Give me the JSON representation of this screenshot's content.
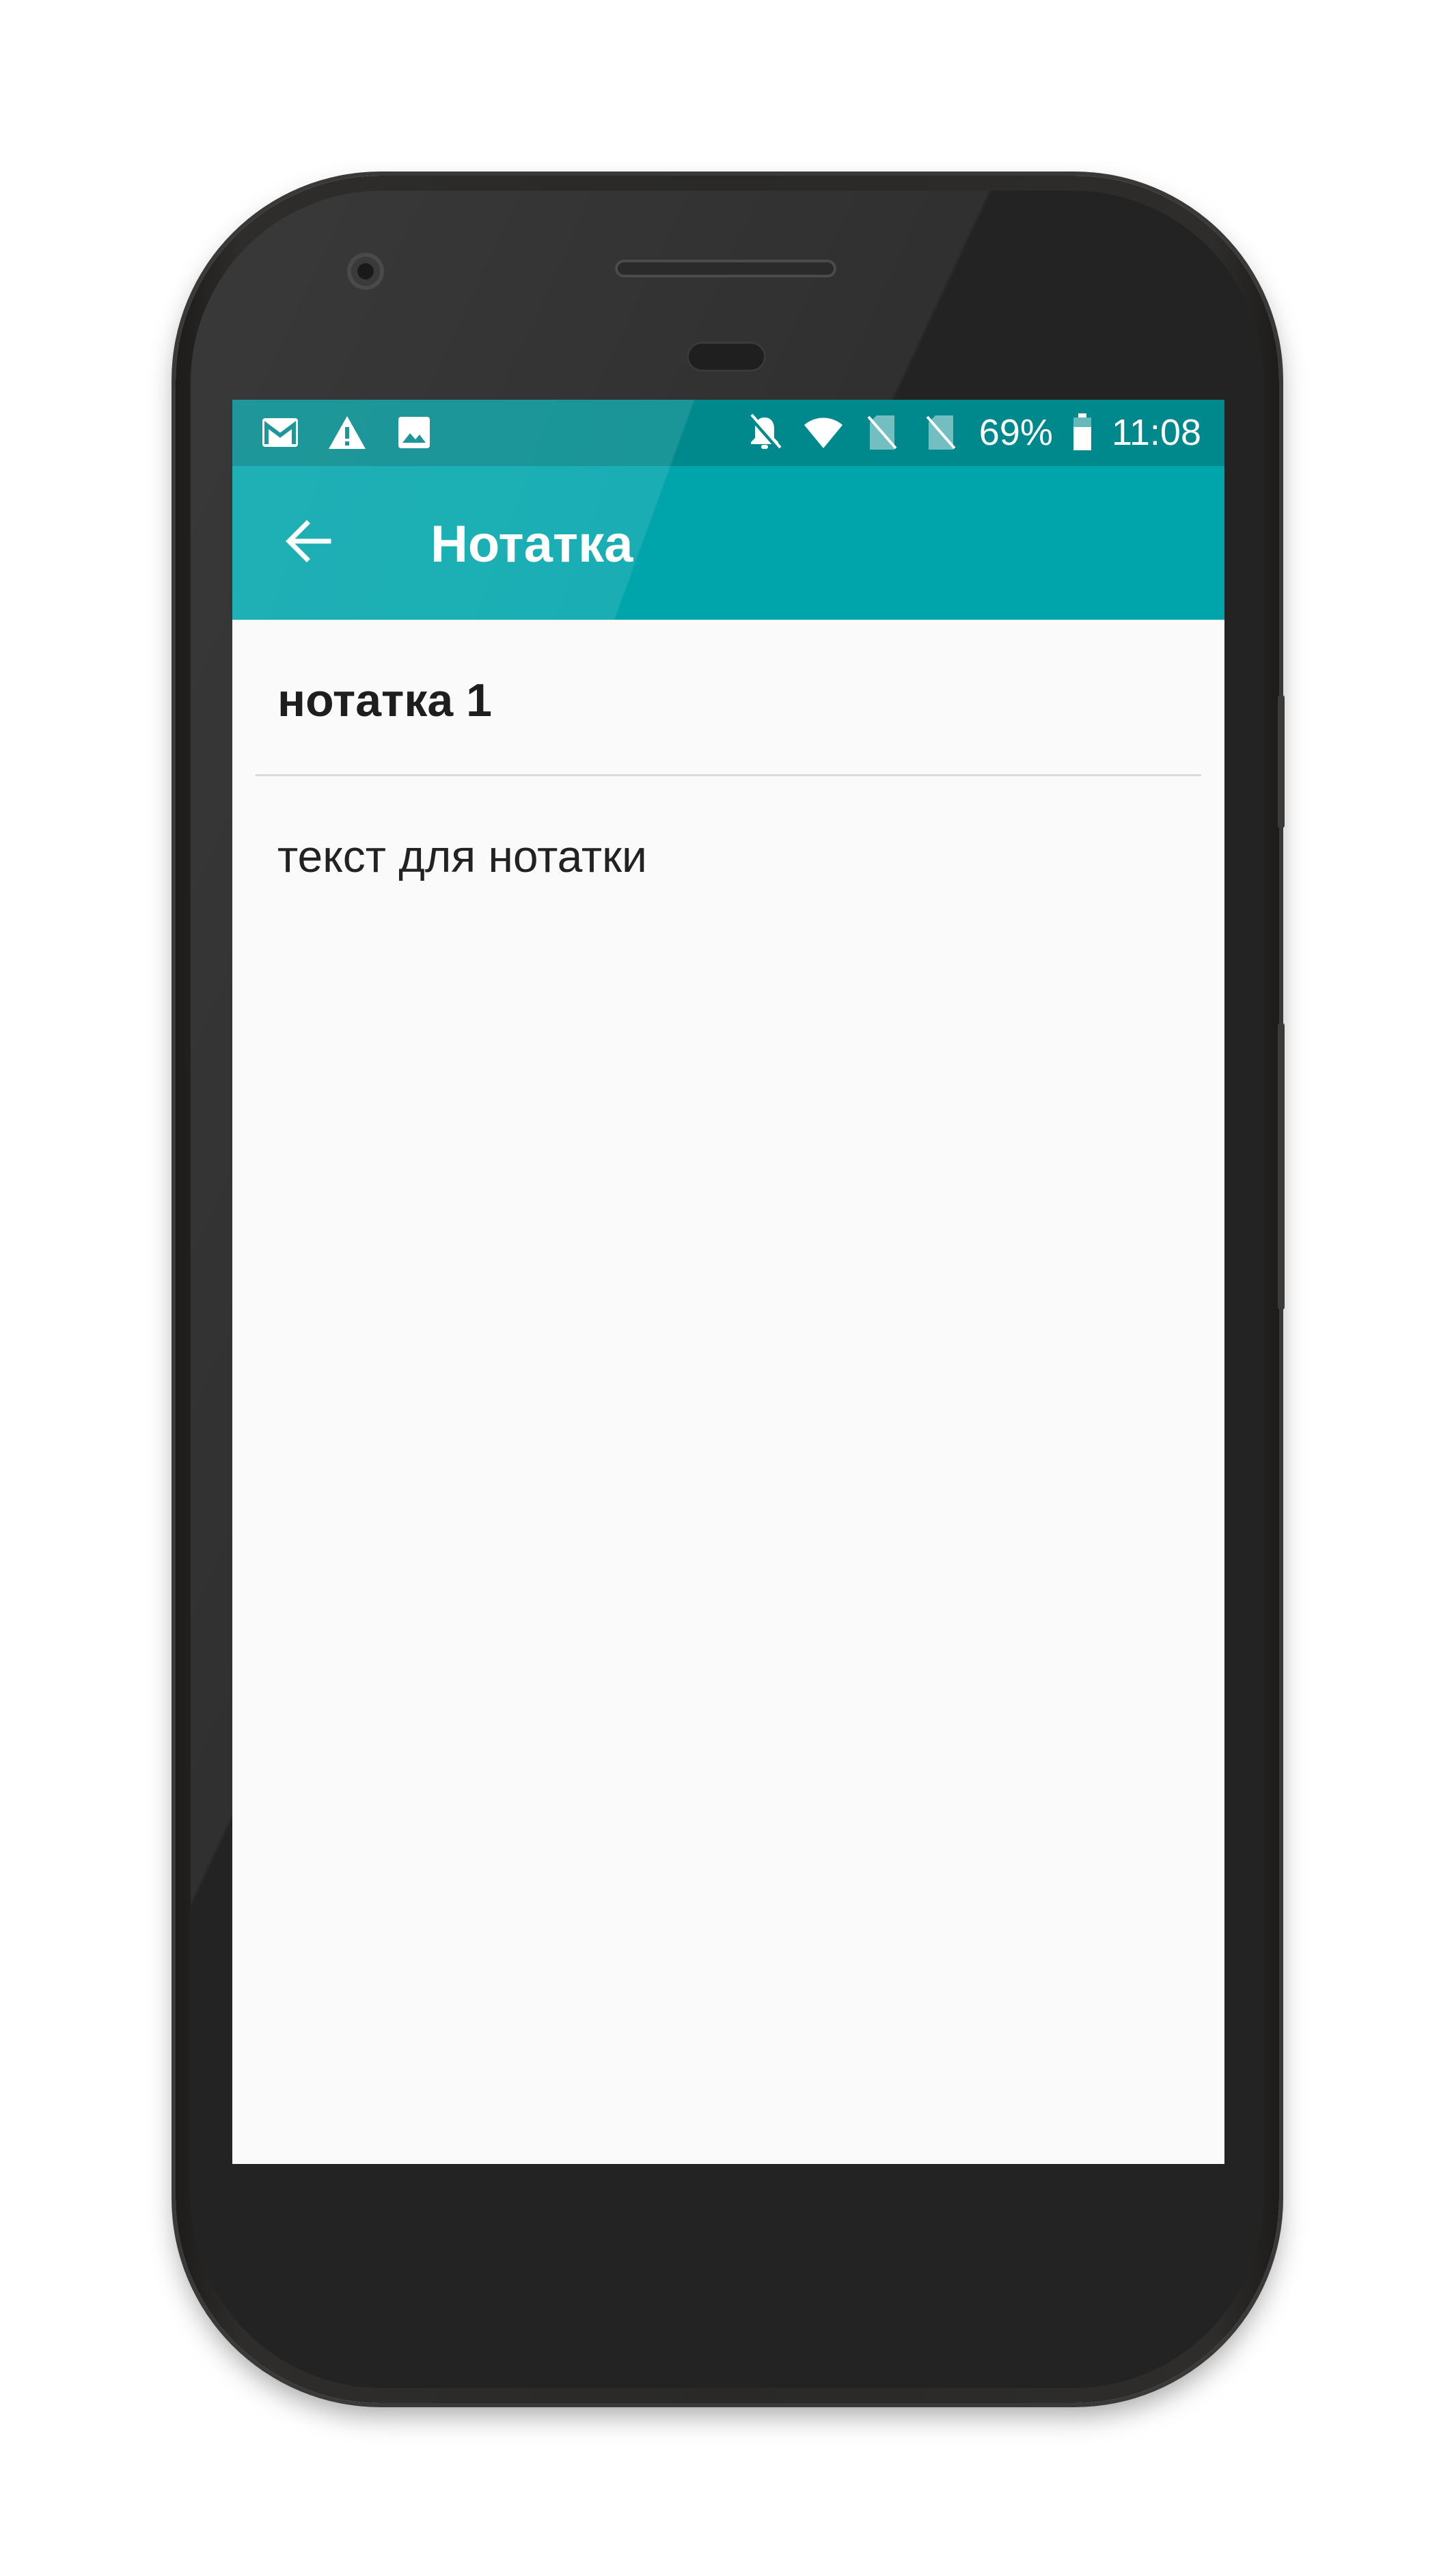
{
  "status_bar": {
    "notification_icons": [
      "gmail-icon",
      "warning-icon",
      "image-icon"
    ],
    "system_icons": [
      "notifications-off-icon",
      "wifi-icon",
      "no-sim-icon",
      "no-sim-icon"
    ],
    "battery_percent": "69%",
    "time": "11:08"
  },
  "app_bar": {
    "back_icon": "arrow-back-icon",
    "title": "Нотатка"
  },
  "note": {
    "title": "нотатка 1",
    "body": "текст для нотатки"
  },
  "colors": {
    "status_bar": "#00898c",
    "app_bar": "#00a5ab",
    "background": "#fafafa",
    "divider": "#d9d9d9",
    "phone_frame": "#2a2928"
  }
}
